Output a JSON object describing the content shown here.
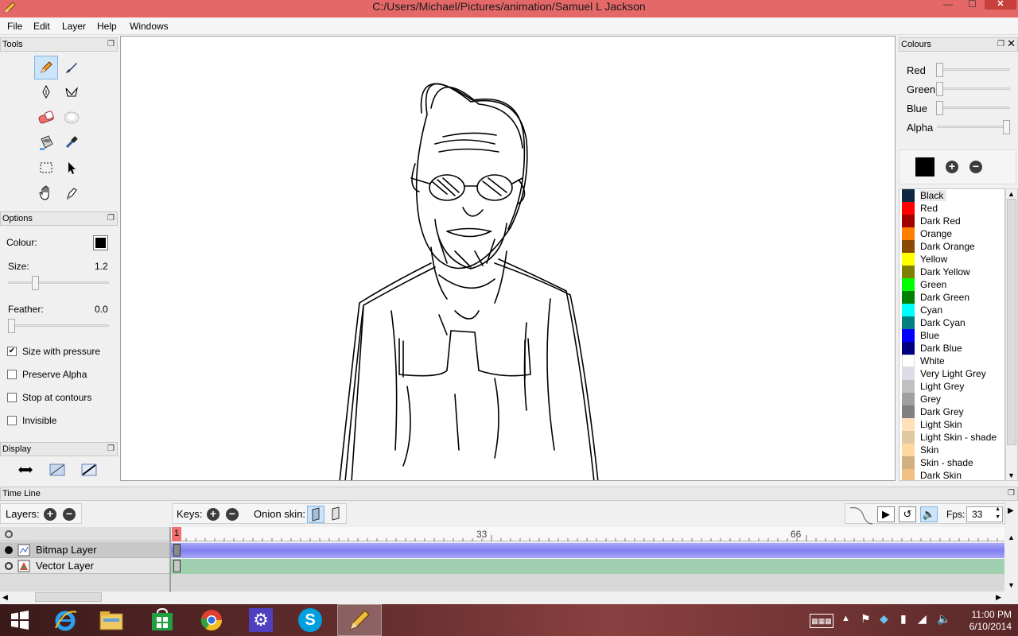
{
  "window": {
    "title": "C:/Users/Michael/Pictures/animation/Samuel L Jackson",
    "minimize": "—",
    "maximize": "☐",
    "close": "✕"
  },
  "menu": [
    "File",
    "Edit",
    "Layer",
    "Help",
    "Windows"
  ],
  "panels": {
    "tools_title": "Tools",
    "options_title": "Options",
    "display_title": "Display",
    "colours_title": "Colours",
    "timeline_title": "Time Line"
  },
  "tools": [
    {
      "name": "pencil-icon",
      "active": true
    },
    {
      "name": "brush-icon"
    },
    {
      "name": "pen-icon"
    },
    {
      "name": "polyline-icon"
    },
    {
      "name": "eraser-icon"
    },
    {
      "name": "smudge-icon"
    },
    {
      "name": "bucket-icon"
    },
    {
      "name": "eyedropper-icon"
    },
    {
      "name": "select-icon"
    },
    {
      "name": "move-icon"
    },
    {
      "name": "hand-icon"
    },
    {
      "name": "smudge-hand-icon"
    }
  ],
  "options": {
    "colour_label": "Colour:",
    "colour_value": "#000000",
    "size_label": "Size:",
    "size_value": "1.2",
    "feather_label": "Feather:",
    "feather_value": "0.0",
    "checkboxes": [
      {
        "label": "Size with pressure",
        "checked": true
      },
      {
        "label": "Preserve Alpha",
        "checked": false
      },
      {
        "label": "Stop at contours",
        "checked": false
      },
      {
        "label": "Invisible",
        "checked": false
      }
    ]
  },
  "colours": {
    "sliders": [
      {
        "label": "Red",
        "value": 0
      },
      {
        "label": "Green",
        "value": 0
      },
      {
        "label": "Blue",
        "value": 0
      },
      {
        "label": "Alpha",
        "value": 1
      }
    ],
    "current": "#000000",
    "palette": [
      {
        "name": "Black",
        "color": "#0e2a42",
        "selected": true
      },
      {
        "name": "Red",
        "color": "#ff0000"
      },
      {
        "name": "Dark Red",
        "color": "#a00000"
      },
      {
        "name": "Orange",
        "color": "#ff8000"
      },
      {
        "name": "Dark Orange",
        "color": "#8a4a00"
      },
      {
        "name": "Yellow",
        "color": "#ffff00"
      },
      {
        "name": "Dark Yellow",
        "color": "#808000"
      },
      {
        "name": "Green",
        "color": "#00ff00"
      },
      {
        "name": "Dark Green",
        "color": "#008000"
      },
      {
        "name": "Cyan",
        "color": "#00ffff"
      },
      {
        "name": "Dark Cyan",
        "color": "#008080"
      },
      {
        "name": "Blue",
        "color": "#0000ff"
      },
      {
        "name": "Dark Blue",
        "color": "#000080"
      },
      {
        "name": "White",
        "color": "#ffffff"
      },
      {
        "name": "Very Light Grey",
        "color": "#dcdce6"
      },
      {
        "name": "Light Grey",
        "color": "#c0c0c0"
      },
      {
        "name": "Grey",
        "color": "#a0a0a0"
      },
      {
        "name": "Dark Grey",
        "color": "#808080"
      },
      {
        "name": "Light Skin",
        "color": "#ffe0b8"
      },
      {
        "name": "Light Skin - shade",
        "color": "#e0c8a0"
      },
      {
        "name": "Skin",
        "color": "#ffd8a0"
      },
      {
        "name": "Skin - shade",
        "color": "#d0b080"
      },
      {
        "name": "Dark Skin",
        "color": "#f0c080"
      }
    ]
  },
  "timeline": {
    "layers_label": "Layers:",
    "keys_label": "Keys:",
    "onion_label": "Onion skin:",
    "fps_label": "Fps:",
    "fps_value": "33",
    "current_frame": "1",
    "ruler_marks": [
      "33",
      "66"
    ],
    "layers": [
      {
        "name": "Bitmap Layer",
        "color": "#8080f0"
      },
      {
        "name": "Vector Layer",
        "color": "#a0d0b0"
      }
    ]
  },
  "taskbar": {
    "apps": [
      "windows-start-icon",
      "internet-explorer-icon",
      "file-explorer-icon",
      "store-icon",
      "chrome-icon",
      "settings-icon",
      "skype-icon",
      "pencil-app-icon"
    ],
    "time": "11:00 PM",
    "date": "6/10/2014"
  }
}
